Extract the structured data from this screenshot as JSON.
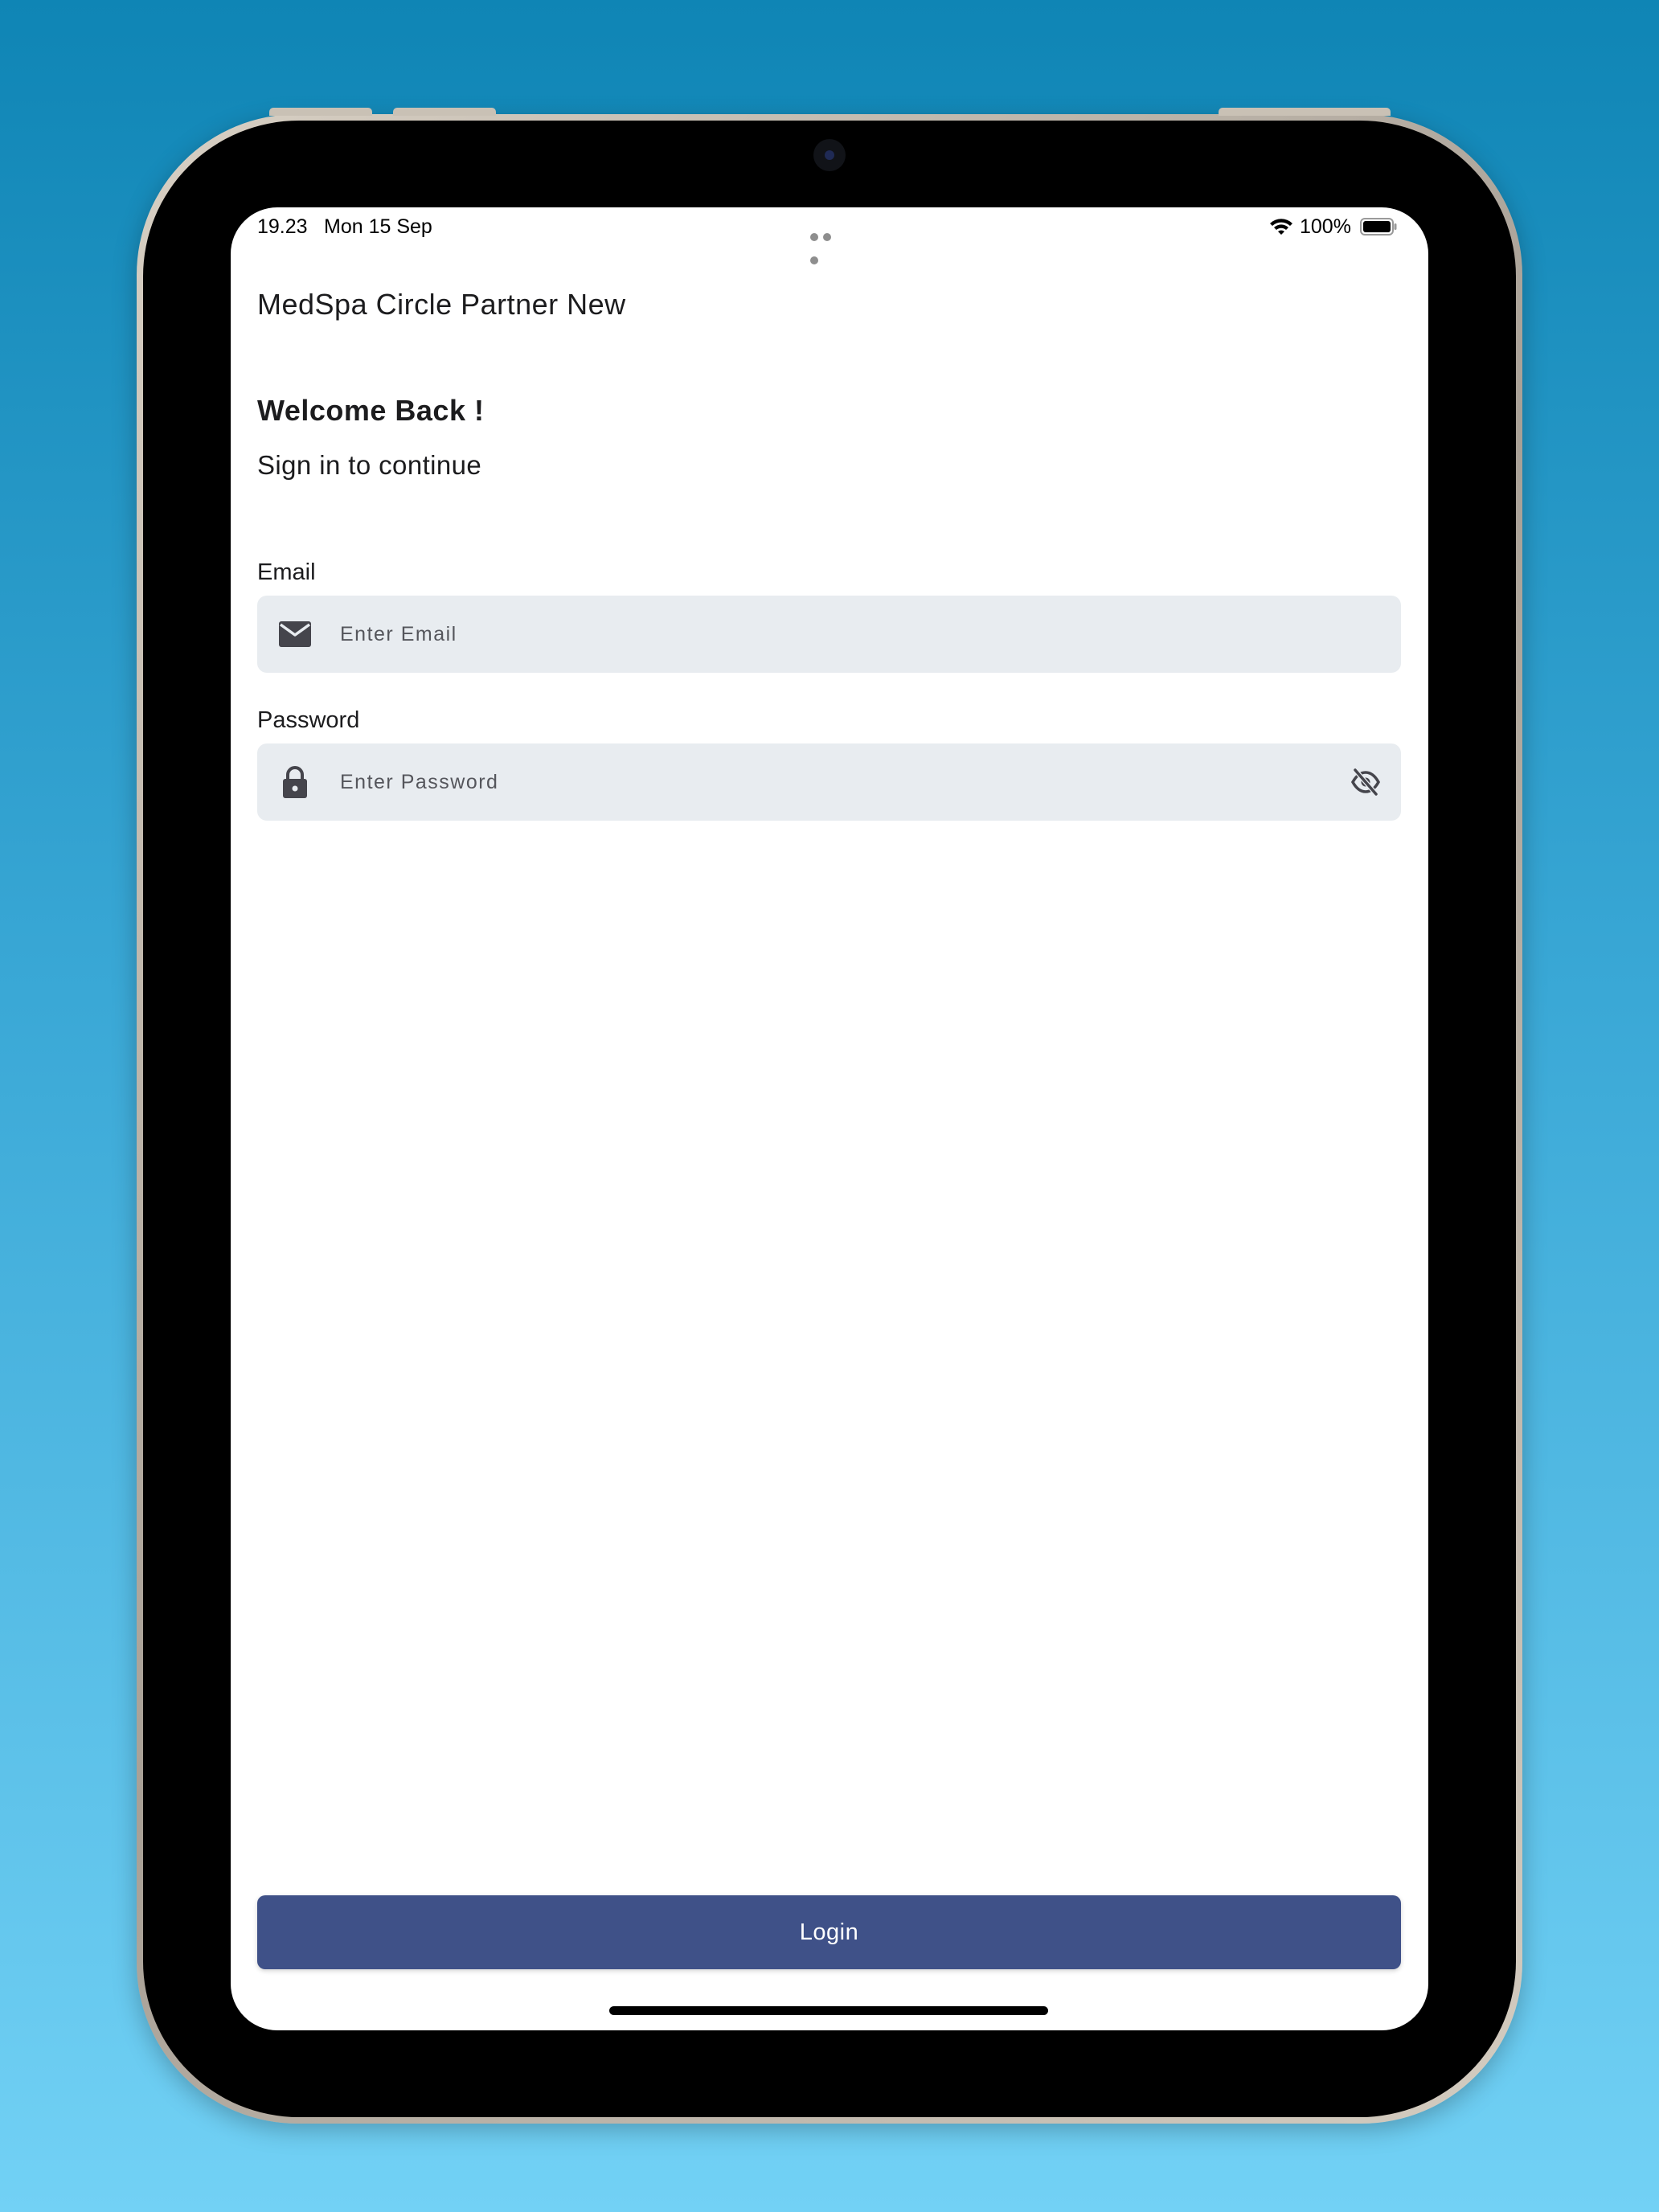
{
  "status_bar": {
    "time": "19.23",
    "date": "Mon 15 Sep",
    "battery_percent": "100%",
    "icons": [
      "wifi-icon",
      "battery-icon",
      "multitasking-dots-icon"
    ]
  },
  "app": {
    "title": "MedSpa Circle Partner New"
  },
  "login": {
    "welcome": "Welcome Back !",
    "subtitle": "Sign in to continue",
    "email": {
      "label": "Email",
      "placeholder": "Enter Email",
      "value": "",
      "icon": "mail-icon"
    },
    "password": {
      "label": "Password",
      "placeholder": "Enter Password",
      "value": "",
      "icon": "lock-icon",
      "toggle_icon": "eye-off-icon"
    },
    "button_label": "Login"
  },
  "colors": {
    "primary_button": "#3f5188",
    "field_background": "#e8ecf0",
    "background_gradient_top": "#0f85b5",
    "background_gradient_bottom": "#72d1f5"
  }
}
